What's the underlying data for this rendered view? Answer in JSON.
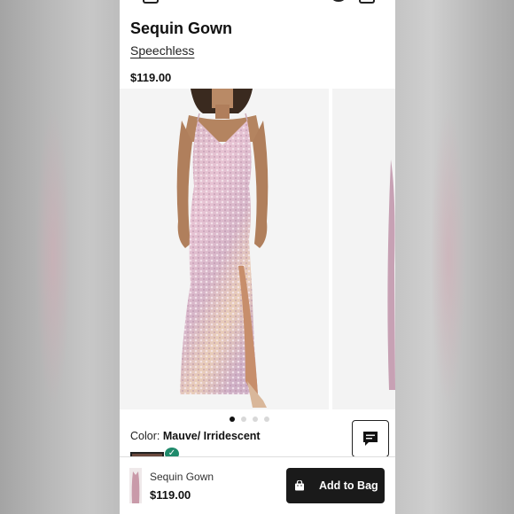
{
  "product": {
    "title": "Sequin Gown",
    "brand": "Speechless",
    "price": "$119.00"
  },
  "gallery": {
    "image_count": 4,
    "active_index": 0,
    "image_description_icon": "dress-photo"
  },
  "color": {
    "label": "Color:",
    "value": "Mauve/ Irridescent",
    "check_icon": "check-icon"
  },
  "chat": {
    "icon": "chat-icon"
  },
  "sticky_bar": {
    "name": "Sequin Gown",
    "price": "$119.00",
    "add_label": "Add to Bag",
    "bag_icon": "shopping-bag-icon",
    "button_color": "#1a1a1a"
  },
  "colors": {
    "accent_check": "#1f8a6b"
  }
}
